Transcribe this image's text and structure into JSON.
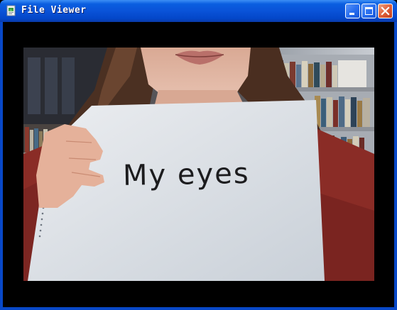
{
  "window": {
    "title": "File Viewer",
    "buttons": {
      "minimize": "minimize-icon",
      "maximize": "maximize-icon",
      "close": "close-icon"
    }
  },
  "image": {
    "sign_text": "My eyes"
  }
}
